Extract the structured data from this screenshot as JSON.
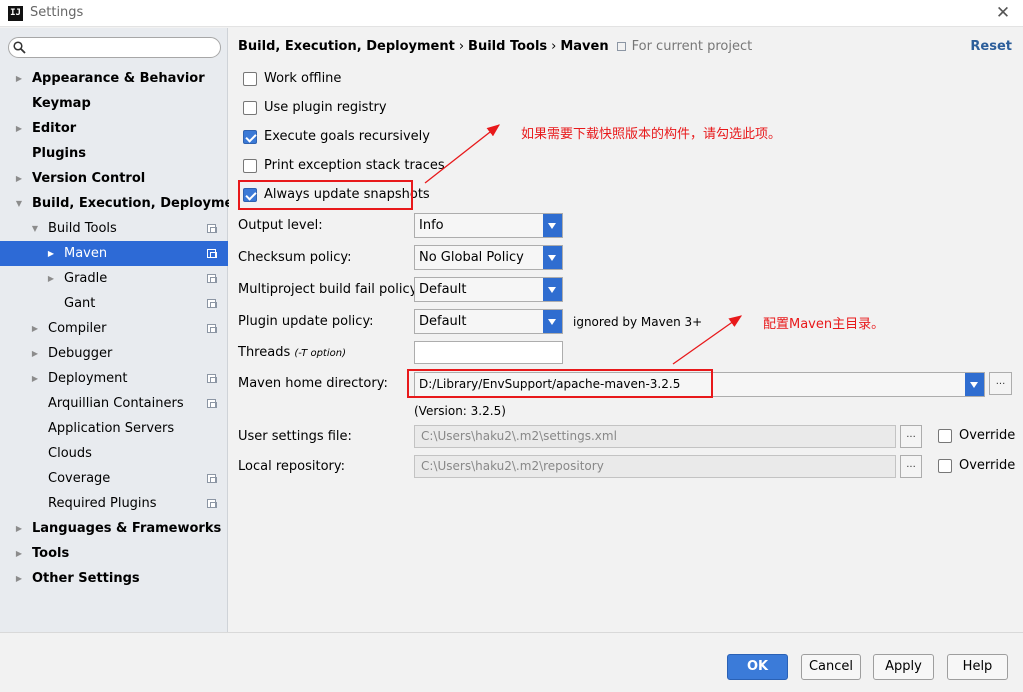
{
  "window": {
    "title": "Settings",
    "app_icon_text": "IJ"
  },
  "search": {
    "placeholder": "",
    "value": ""
  },
  "tree": [
    {
      "label": "Appearance & Behavior",
      "level": 0,
      "arrow": "right"
    },
    {
      "label": "Keymap",
      "level": 0,
      "arrow": "none"
    },
    {
      "label": "Editor",
      "level": 0,
      "arrow": "right"
    },
    {
      "label": "Plugins",
      "level": 0,
      "arrow": "none"
    },
    {
      "label": "Version Control",
      "level": 0,
      "arrow": "right"
    },
    {
      "label": "Build, Execution, Deployment",
      "level": 0,
      "arrow": "down"
    },
    {
      "label": "Build Tools",
      "level": 1,
      "arrow": "down",
      "project_icon": true
    },
    {
      "label": "Maven",
      "level": 2,
      "arrow": "right",
      "project_icon": true,
      "selected": true
    },
    {
      "label": "Gradle",
      "level": 2,
      "arrow": "right",
      "project_icon": true
    },
    {
      "label": "Gant",
      "level": 2,
      "arrow": "none",
      "project_icon": true
    },
    {
      "label": "Compiler",
      "level": 1,
      "arrow": "right",
      "project_icon": true
    },
    {
      "label": "Debugger",
      "level": 1,
      "arrow": "right"
    },
    {
      "label": "Deployment",
      "level": 1,
      "arrow": "right",
      "project_icon": true
    },
    {
      "label": "Arquillian Containers",
      "level": 1,
      "arrow": "none",
      "project_icon": true
    },
    {
      "label": "Application Servers",
      "level": 1,
      "arrow": "none"
    },
    {
      "label": "Clouds",
      "level": 1,
      "arrow": "none"
    },
    {
      "label": "Coverage",
      "level": 1,
      "arrow": "none",
      "project_icon": true
    },
    {
      "label": "Required Plugins",
      "level": 1,
      "arrow": "none",
      "project_icon": true
    },
    {
      "label": "Languages & Frameworks",
      "level": 0,
      "arrow": "right"
    },
    {
      "label": "Tools",
      "level": 0,
      "arrow": "right"
    },
    {
      "label": "Other Settings",
      "level": 0,
      "arrow": "right"
    }
  ],
  "breadcrumb": {
    "items": [
      "Build, Execution, Deployment",
      "Build Tools",
      "Maven"
    ],
    "separator": "›",
    "for_project": "For current project"
  },
  "reset_label": "Reset",
  "checkboxes": {
    "work_offline": {
      "label": "Work offline",
      "checked": false
    },
    "use_plugin_registry": {
      "label": "Use plugin registry",
      "checked": false
    },
    "execute_goals_recursively": {
      "label": "Execute goals recursively",
      "checked": true
    },
    "print_exception_stack_traces": {
      "label": "Print exception stack traces",
      "checked": false
    },
    "always_update_snapshots": {
      "label": "Always update snapshots",
      "checked": true
    }
  },
  "fields": {
    "output_level": {
      "label": "Output level:",
      "value": "Info"
    },
    "checksum_policy": {
      "label": "Checksum policy:",
      "value": "No Global Policy"
    },
    "multiproject_fail_policy": {
      "label": "Multiproject build fail policy:",
      "value": "Default"
    },
    "plugin_update_policy": {
      "label": "Plugin update policy:",
      "value": "Default",
      "note": "ignored by Maven 3+"
    },
    "threads": {
      "label": "Threads",
      "hint": "(-T option)",
      "value": ""
    },
    "maven_home": {
      "label": "Maven home directory:",
      "value": "D:/Library/EnvSupport/apache-maven-3.2.5",
      "version": "(Version: 3.2.5)"
    },
    "user_settings": {
      "label": "User settings file:",
      "value": "C:\\Users\\haku2\\.m2\\settings.xml",
      "override_label": "Override"
    },
    "local_repository": {
      "label": "Local repository:",
      "value": "C:\\Users\\haku2\\.m2\\repository",
      "override_label": "Override"
    }
  },
  "annotations": {
    "snapshots": "如果需要下载快照版本的构件，请勾选此项。",
    "maven_home": "配置Maven主目录。",
    "color": "#e8191b"
  },
  "buttons": {
    "ok": "OK",
    "cancel": "Cancel",
    "apply": "Apply",
    "help": "Help"
  },
  "colors": {
    "selection": "#2d6ad6",
    "primary_button": "#3b7bd9",
    "link": "#2c5e9a"
  }
}
